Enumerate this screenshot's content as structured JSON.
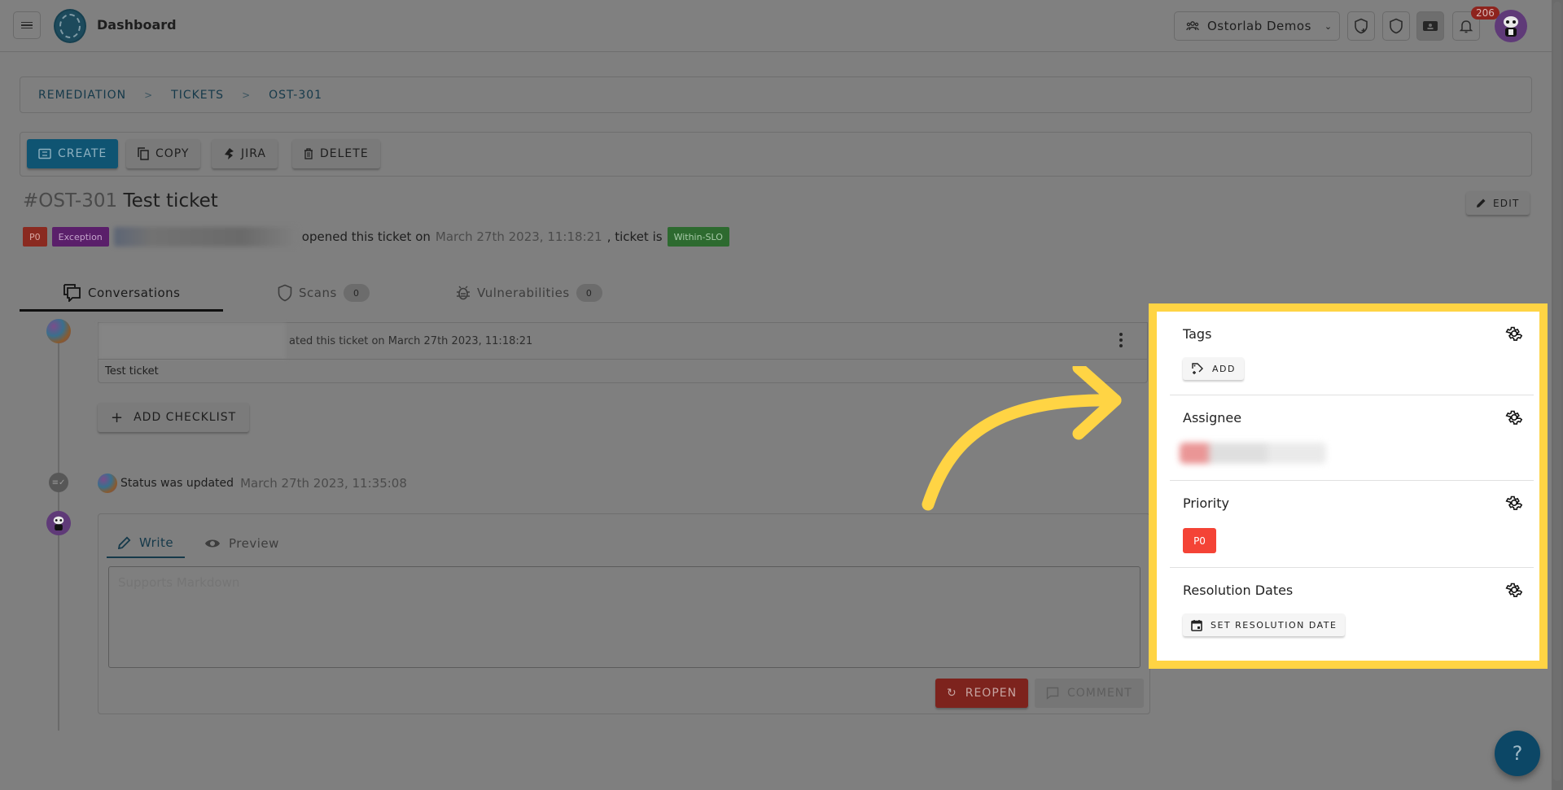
{
  "header": {
    "app_title": "Dashboard",
    "org_selector": {
      "label": "Ostorlab Demos",
      "icon": "group-icon"
    },
    "icons": [
      "shield-plus-icon",
      "shield-icon",
      "ticket-icon",
      "bell-icon"
    ],
    "notification_count": "206",
    "avatar_icon": "panda-avatar"
  },
  "breadcrumb": {
    "items": [
      "REMEDIATION",
      "TICKETS",
      "OST-301"
    ],
    "separator": ">"
  },
  "toolbar": {
    "create_label": "CREATE",
    "copy_label": "COPY",
    "jira_label": "JIRA",
    "delete_label": "DELETE"
  },
  "ticket": {
    "id": "#OST-301",
    "title": "Test ticket",
    "edit_label": "EDIT",
    "priority_badge": "P0",
    "type_badge": "Exception",
    "opened_text": "opened this ticket on",
    "opened_date": "March 27th 2023, 11:18:21",
    "status_prefix": ", ticket is",
    "slo_badge": "Within-SLO",
    "colors": {
      "priority": "#f44336",
      "exception": "#9c27b0",
      "slo": "#4caf50",
      "primary": "#1a6f98"
    }
  },
  "tabs": [
    {
      "label": "Conversations",
      "icon": "conversations-icon",
      "active": true
    },
    {
      "label": "Scans",
      "icon": "shield-icon",
      "count": "0"
    },
    {
      "label": "Vulnerabilities",
      "icon": "bug-icon",
      "count": "0"
    }
  ],
  "conversation": {
    "created_text": "ated this ticket on March 27th 2023, 11:18:21",
    "body": "Test ticket",
    "add_checklist_label": "ADD CHECKLIST",
    "status_text": "Status was updated",
    "status_date": "March 27th 2023, 11:35:08"
  },
  "editor": {
    "write_label": "Write",
    "preview_label": "Preview",
    "placeholder": "Supports Markdown",
    "reopen_label": "REOPEN",
    "comment_label": "COMMENT"
  },
  "side_panel": {
    "tags_title": "Tags",
    "tags_add_label": "ADD",
    "assignee_title": "Assignee",
    "priority_title": "Priority",
    "priority_value": "P0",
    "resolution_title": "Resolution Dates",
    "resolution_button": "SET RESOLUTION DATE",
    "highlight_color": "#ffd444"
  },
  "help_label": "?"
}
